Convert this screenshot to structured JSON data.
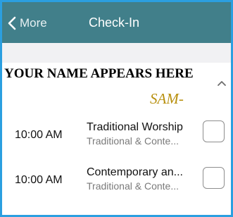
{
  "header": {
    "back_label": "More",
    "title": "Check-In"
  },
  "section": {
    "name_line": "YOUR NAME APPEARS HERE",
    "signature": "SAM-"
  },
  "services": [
    {
      "time": "10:00 AM",
      "title": "Traditional Worship",
      "subtitle": "Traditional & Conte...",
      "checked": false
    },
    {
      "time": "10:00 AM",
      "title": "Contemporary an...",
      "subtitle": "Traditional & Conte...",
      "checked": false
    }
  ],
  "colors": {
    "header_bg": "#417f8a",
    "frame_border": "#2b9fe0",
    "signature": "#b8900f"
  }
}
